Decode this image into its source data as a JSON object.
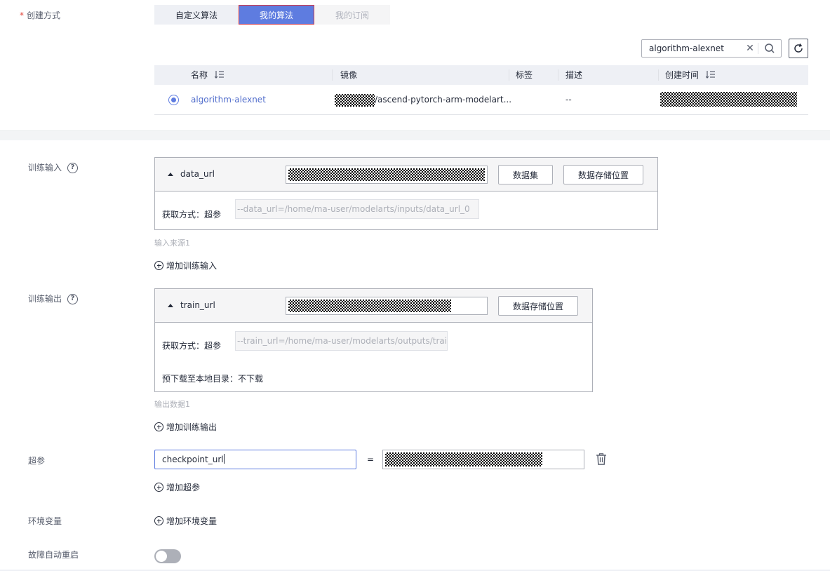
{
  "create_method": {
    "label": "创建方式",
    "required_mark": "*",
    "options": [
      "自定义算法",
      "我的算法",
      "我的订阅"
    ],
    "selected": "我的算法"
  },
  "search": {
    "value": "algorithm-alexnet"
  },
  "table": {
    "columns": [
      "名称",
      "镜像",
      "标签",
      "描述",
      "创建时间"
    ],
    "rows": [
      {
        "name": "algorithm-alexnet",
        "image_suffix": "/ascend-pytorch-arm-modelart...",
        "tags": "",
        "description": "--"
      }
    ]
  },
  "training_input": {
    "label": "训练输入",
    "name": "data_url",
    "buttons": [
      "数据集",
      "数据存储位置"
    ],
    "method_label": "获取方式：超参",
    "method_value": "--data_url=/home/ma-user/modelarts/inputs/data_url_0",
    "source_hint": "输入来源1",
    "add_label": "增加训练输入"
  },
  "training_output": {
    "label": "训练输出",
    "name": "train_url",
    "buttons": [
      "数据存储位置"
    ],
    "method_label": "获取方式：超参",
    "method_value": "--train_url=/home/ma-user/modelarts/outputs/train_...",
    "predownload": "预下载至本地目录：不下载",
    "source_hint": "输出数据1",
    "add_label": "增加训练输出"
  },
  "hyperparams": {
    "label": "超参",
    "key": "checkpoint_url",
    "equals": "=",
    "add_label": "增加超参"
  },
  "env_vars": {
    "label": "环境变量",
    "add_label": "增加环境变量"
  },
  "auto_restart": {
    "label": "故障自动重启",
    "enabled": false
  },
  "icons": [
    "sort-icon",
    "search-icon",
    "clear-icon",
    "refresh-icon",
    "help-icon",
    "collapse-icon",
    "add-icon",
    "delete-icon"
  ]
}
